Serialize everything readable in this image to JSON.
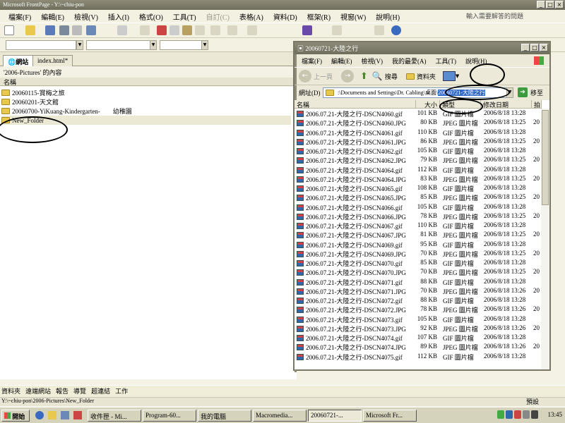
{
  "app": {
    "title": "Microsoft FrontPage - Y:\\~chiu-pon",
    "menu": [
      "檔案(F)",
      "編輯(E)",
      "檢視(V)",
      "插入(I)",
      "格式(O)",
      "工具(T)",
      "自訂(C)",
      "表格(A)",
      "資料(D)",
      "框架(R)",
      "視窗(W)",
      "說明(H)"
    ],
    "disabled_menu_index": 6,
    "help_placeholder": "輸入需要解答的問題"
  },
  "site": {
    "tabs": [
      "網站",
      "index.html*"
    ],
    "folder_header": "'2006-Pictures' 的內容",
    "column_name": "名稱",
    "folders": [
      "20060115-賞梅之旅",
      "20060201-天文館",
      "20060700-YiKuang-Kindergarten-　　幼稚園",
      "New_Folder"
    ]
  },
  "views_bar": [
    "資料夾",
    "遠端網站",
    "報告",
    "導覽",
    "超連結",
    "工作"
  ],
  "path": "Y:\\~chiu-pon\\2006-Pictures\\New_Folder",
  "preview_label": "預設",
  "explorer": {
    "title": "20060721-大陸之行",
    "menu": [
      "檔案(F)",
      "編輯(E)",
      "檢視(V)",
      "我的最愛(A)",
      "工具(T)",
      "說明(H)"
    ],
    "back": "上一頁",
    "search": "搜尋",
    "folders": "資料夾",
    "address_label": "網址(D)",
    "address_prefix": ":\\Documents and Settings\\Dr. Cabling\\桌面\\",
    "address_highlight": "20060721-大陸之行",
    "go": "移至",
    "columns": [
      "名稱",
      "大小",
      "類型",
      "修改日期",
      "拍"
    ],
    "files": [
      {
        "name": "2006.07.21-大陸之行-DSCN4060.gif",
        "size": "101 KB",
        "type": "GIF 圖片檔",
        "date": "2006/8/18 13:28",
        "extra": ""
      },
      {
        "name": "2006.07.21-大陸之行-DSCN4060.JPG",
        "size": "80 KB",
        "type": "JPEG 圖片檔",
        "date": "2006/8/18 13:25",
        "extra": "20"
      },
      {
        "name": "2006.07.21-大陸之行-DSCN4061.gif",
        "size": "110 KB",
        "type": "GIF 圖片檔",
        "date": "2006/8/18 13:28",
        "extra": ""
      },
      {
        "name": "2006.07.21-大陸之行-DSCN4061.JPG",
        "size": "86 KB",
        "type": "JPEG 圖片檔",
        "date": "2006/8/18 13:25",
        "extra": "20"
      },
      {
        "name": "2006.07.21-大陸之行-DSCN4062.gif",
        "size": "105 KB",
        "type": "GIF 圖片檔",
        "date": "2006/8/18 13:28",
        "extra": ""
      },
      {
        "name": "2006.07.21-大陸之行-DSCN4062.JPG",
        "size": "79 KB",
        "type": "JPEG 圖片檔",
        "date": "2006/8/18 13:25",
        "extra": "20"
      },
      {
        "name": "2006.07.21-大陸之行-DSCN4064.gif",
        "size": "112 KB",
        "type": "GIF 圖片檔",
        "date": "2006/8/18 13:28",
        "extra": ""
      },
      {
        "name": "2006.07.21-大陸之行-DSCN4064.JPG",
        "size": "83 KB",
        "type": "JPEG 圖片檔",
        "date": "2006/8/18 13:25",
        "extra": "20"
      },
      {
        "name": "2006.07.21-大陸之行-DSCN4065.gif",
        "size": "108 KB",
        "type": "GIF 圖片檔",
        "date": "2006/8/18 13:28",
        "extra": ""
      },
      {
        "name": "2006.07.21-大陸之行-DSCN4065.JPG",
        "size": "85 KB",
        "type": "JPEG 圖片檔",
        "date": "2006/8/18 13:25",
        "extra": "20"
      },
      {
        "name": "2006.07.21-大陸之行-DSCN4066.gif",
        "size": "105 KB",
        "type": "GIF 圖片檔",
        "date": "2006/8/18 13:28",
        "extra": ""
      },
      {
        "name": "2006.07.21-大陸之行-DSCN4066.JPG",
        "size": "78 KB",
        "type": "JPEG 圖片檔",
        "date": "2006/8/18 13:25",
        "extra": "20"
      },
      {
        "name": "2006.07.21-大陸之行-DSCN4067.gif",
        "size": "110 KB",
        "type": "GIF 圖片檔",
        "date": "2006/8/18 13:28",
        "extra": ""
      },
      {
        "name": "2006.07.21-大陸之行-DSCN4067.JPG",
        "size": "81 KB",
        "type": "JPEG 圖片檔",
        "date": "2006/8/18 13:25",
        "extra": "20"
      },
      {
        "name": "2006.07.21-大陸之行-DSCN4069.gif",
        "size": "95 KB",
        "type": "GIF 圖片檔",
        "date": "2006/8/18 13:28",
        "extra": ""
      },
      {
        "name": "2006.07.21-大陸之行-DSCN4069.JPG",
        "size": "70 KB",
        "type": "JPEG 圖片檔",
        "date": "2006/8/18 13:25",
        "extra": "20"
      },
      {
        "name": "2006.07.21-大陸之行-DSCN4070.gif",
        "size": "85 KB",
        "type": "GIF 圖片檔",
        "date": "2006/8/18 13:28",
        "extra": ""
      },
      {
        "name": "2006.07.21-大陸之行-DSCN4070.JPG",
        "size": "70 KB",
        "type": "JPEG 圖片檔",
        "date": "2006/8/18 13:25",
        "extra": "20"
      },
      {
        "name": "2006.07.21-大陸之行-DSCN4071.gif",
        "size": "88 KB",
        "type": "GIF 圖片檔",
        "date": "2006/8/18 13:28",
        "extra": ""
      },
      {
        "name": "2006.07.21-大陸之行-DSCN4071.JPG",
        "size": "70 KB",
        "type": "JPEG 圖片檔",
        "date": "2006/8/18 13:26",
        "extra": "20"
      },
      {
        "name": "2006.07.21-大陸之行-DSCN4072.gif",
        "size": "88 KB",
        "type": "GIF 圖片檔",
        "date": "2006/8/18 13:28",
        "extra": ""
      },
      {
        "name": "2006.07.21-大陸之行-DSCN4072.JPG",
        "size": "78 KB",
        "type": "JPEG 圖片檔",
        "date": "2006/8/18 13:26",
        "extra": "20"
      },
      {
        "name": "2006.07.21-大陸之行-DSCN4073.gif",
        "size": "105 KB",
        "type": "GIF 圖片檔",
        "date": "2006/8/18 13:28",
        "extra": ""
      },
      {
        "name": "2006.07.21-大陸之行-DSCN4073.JPG",
        "size": "92 KB",
        "type": "JPEG 圖片檔",
        "date": "2006/8/18 13:26",
        "extra": "20"
      },
      {
        "name": "2006.07.21-大陸之行-DSCN4074.gif",
        "size": "107 KB",
        "type": "GIF 圖片檔",
        "date": "2006/8/18 13:28",
        "extra": ""
      },
      {
        "name": "2006.07.21-大陸之行-DSCN4074.JPG",
        "size": "89 KB",
        "type": "JPEG 圖片檔",
        "date": "2006/8/18 13:26",
        "extra": "20"
      },
      {
        "name": "2006.07.21-大陸之行-DSCN4075.gif",
        "size": "112 KB",
        "type": "GIF 圖片檔",
        "date": "2006/8/18 13:28",
        "extra": ""
      }
    ]
  },
  "taskbar": {
    "start": "開始",
    "tasks": [
      "收件匣 - Mi...",
      "Program-60...",
      "我的電腦",
      "Macromedia...",
      "20060721-...",
      "Microsoft Fr..."
    ],
    "active_index": 4,
    "clock": "13:45"
  },
  "icons": {
    "folder": "folder-icon",
    "image_file": "image-file-icon",
    "search": "search-icon",
    "back": "back-arrow-icon",
    "forward": "forward-arrow-icon",
    "up": "up-folder-icon",
    "go": "go-arrow-icon",
    "windows_logo": "windows-logo-icon"
  },
  "colors": {
    "titlebar": "#6f6d5c",
    "folder": "#e9c84e",
    "highlight": "#316ac5",
    "window_bg": "#ece9d8"
  }
}
